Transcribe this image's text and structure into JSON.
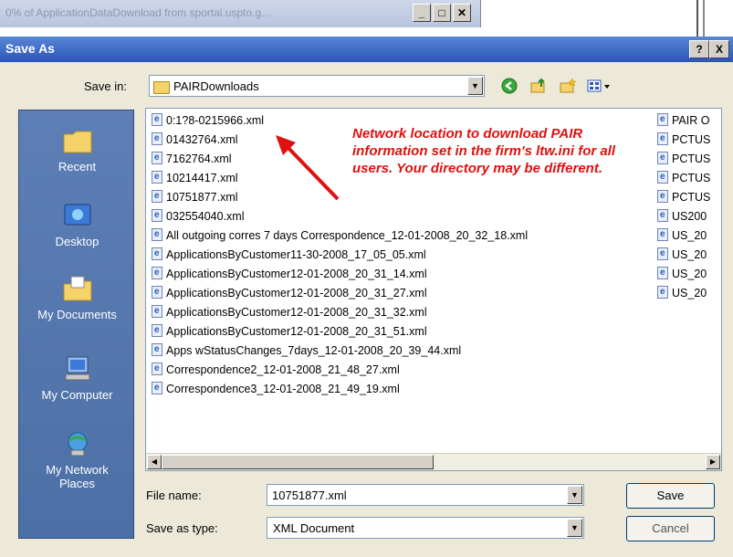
{
  "background_window": {
    "title": "0% of ApplicationDataDownload from sportal.uspto.g..."
  },
  "dialog": {
    "title": "Save As",
    "help_label": "?",
    "close_label": "X"
  },
  "save_in": {
    "label": "Save in:",
    "value": "PAIRDownloads"
  },
  "places": [
    {
      "label": "Recent",
      "icon": "recent-folder-icon"
    },
    {
      "label": "Desktop",
      "icon": "desktop-icon"
    },
    {
      "label": "My Documents",
      "icon": "my-documents-icon"
    },
    {
      "label": "My Computer",
      "icon": "my-computer-icon"
    },
    {
      "label": "My Network Places",
      "icon": "network-places-icon"
    }
  ],
  "files_col1": [
    "0:1?8-0215966.xml",
    "01432764.xml",
    "7162764.xml",
    "10214417.xml",
    "10751877.xml",
    "032554040.xml",
    "All outgoing corres 7 days Correspondence_12-01-2008_20_32_18.xml",
    "ApplicationsByCustomer11-30-2008_17_05_05.xml",
    "ApplicationsByCustomer12-01-2008_20_31_14.xml",
    "ApplicationsByCustomer12-01-2008_20_31_27.xml",
    "ApplicationsByCustomer12-01-2008_20_31_32.xml",
    "ApplicationsByCustomer12-01-2008_20_31_51.xml",
    "Apps wStatusChanges_7days_12-01-2008_20_39_44.xml",
    "Correspondence2_12-01-2008_21_48_27.xml",
    "Correspondence3_12-01-2008_21_49_19.xml"
  ],
  "files_col2": [
    "PAIR O",
    "PCTUS",
    "PCTUS",
    "PCTUS",
    "PCTUS",
    "US200",
    "US_20",
    "US_20",
    "US_20",
    "US_20"
  ],
  "annotation": "Network location to download PAIR information set in the firm's ltw.ini for all users. Your directory may be different.",
  "file_name": {
    "label": "File name:",
    "value": "10751877.xml"
  },
  "save_as_type": {
    "label": "Save as type:",
    "value": "XML Document"
  },
  "buttons": {
    "save": "Save",
    "cancel": "Cancel"
  },
  "colors": {
    "annotation": "#e01010",
    "titlebar": "#2a55b8",
    "places_bar": "#4c6fa6"
  }
}
